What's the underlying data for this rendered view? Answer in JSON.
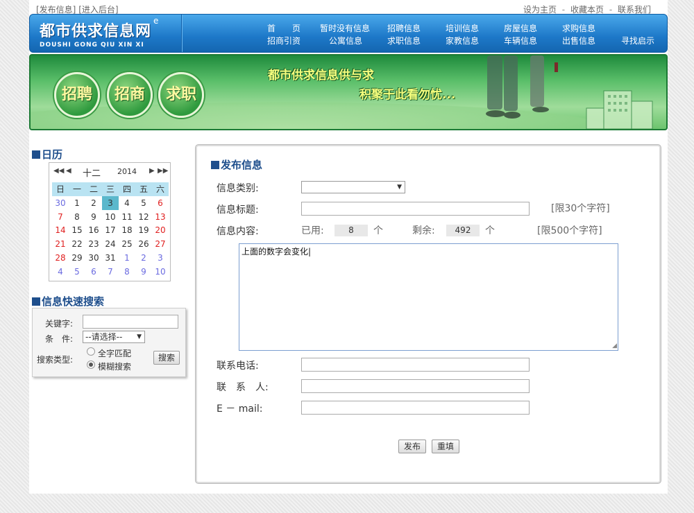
{
  "topbar": {
    "left_links": [
      "[发布信息]",
      "[进入后台]"
    ],
    "right_links": [
      "设为主页",
      "收藏本页",
      "联系我们"
    ],
    "separator": "-"
  },
  "header": {
    "logo_cn": "都市供求信息网",
    "logo_en": "DOUSHI  GONG QIU XIN XI",
    "logo_mark": "e",
    "nav_row1": [
      "首　　页",
      "暂时没有信息",
      "招聘信息",
      "培训信息",
      "房屋信息",
      "求购信息"
    ],
    "nav_row2": [
      "招商引资",
      "公寓信息",
      "求职信息",
      "家教信息",
      "车辆信息",
      "出售信息",
      "寻找启示"
    ]
  },
  "banner": {
    "buttons": [
      "招聘",
      "招商",
      "求职"
    ],
    "slogan_line1": "都市供求信息供与求",
    "slogan_line2": "积聚于此看勿忧..."
  },
  "calendar": {
    "title": "日历",
    "month": "十二",
    "year": "2014",
    "nav": {
      "prev_year": "◀◀",
      "prev_month": "◀",
      "next_month": "▶",
      "next_year": "▶▶"
    },
    "weekdays": [
      "日",
      "一",
      "二",
      "三",
      "四",
      "五",
      "六"
    ],
    "weeks": [
      [
        "30",
        "1",
        "2",
        "3",
        "4",
        "5",
        "6"
      ],
      [
        "7",
        "8",
        "9",
        "10",
        "11",
        "12",
        "13"
      ],
      [
        "14",
        "15",
        "16",
        "17",
        "18",
        "19",
        "20"
      ],
      [
        "21",
        "22",
        "23",
        "24",
        "25",
        "26",
        "27"
      ],
      [
        "28",
        "29",
        "30",
        "31",
        "1",
        "2",
        "3"
      ],
      [
        "4",
        "5",
        "6",
        "7",
        "8",
        "9",
        "10"
      ]
    ],
    "today": "3"
  },
  "quick_search": {
    "title": "信息快速搜索",
    "keyword_label": "关键字:",
    "keyword_value": "",
    "condition_label": "条　件:",
    "condition_value": "--请选择--",
    "type_label": "搜索类型:",
    "type_options": [
      "全字匹配",
      "模糊搜索"
    ],
    "type_selected": "模糊搜索",
    "search_button": "搜索"
  },
  "form": {
    "title": "发布信息",
    "category_label": "信息类别:",
    "category_value": "",
    "title_label": "信息标题:",
    "title_value": "",
    "title_hint": "[限30个字符]",
    "content_label": "信息内容:",
    "used_label": "已用:",
    "used_value": "8",
    "unit": "个",
    "remain_label": "剩余:",
    "remain_value": "492",
    "content_hint": "[限500个字符]",
    "content_value": "上面的数字会变化|",
    "phone_label": "联系电话:",
    "phone_value": "",
    "contact_label": "联　系　人:",
    "contact_value": "",
    "email_label": "E － mail:",
    "email_value": "",
    "submit_button": "发布",
    "reset_button": "重填"
  }
}
